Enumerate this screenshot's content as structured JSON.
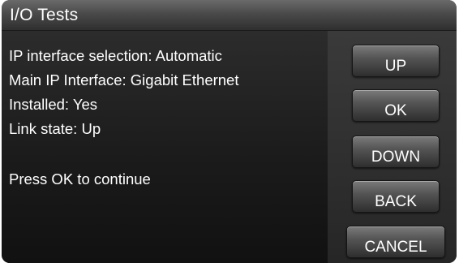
{
  "window": {
    "title": "I/O Tests"
  },
  "info": {
    "lines": [
      "IP interface selection: Automatic",
      "Main IP Interface: Gigabit Ethernet",
      "Installed: Yes",
      "Link state: Up"
    ],
    "prompt": "Press OK to continue"
  },
  "buttons": {
    "up": "UP",
    "ok": "OK",
    "down": "DOWN",
    "back": "BACK",
    "cancel": "CANCEL"
  }
}
